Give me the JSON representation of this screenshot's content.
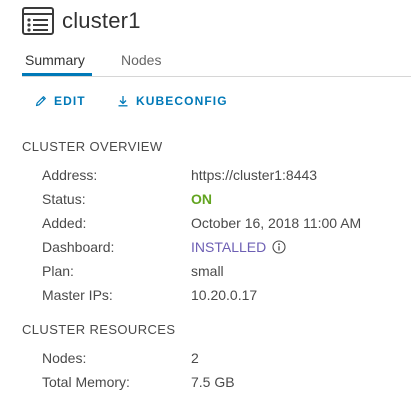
{
  "header": {
    "title": "cluster1",
    "icon": "cluster-list-icon"
  },
  "tabs": [
    {
      "label": "Summary",
      "active": true
    },
    {
      "label": "Nodes",
      "active": false
    }
  ],
  "actions": {
    "edit_label": "EDIT",
    "kubeconfig_label": "KUBECONFIG"
  },
  "overview": {
    "title": "CLUSTER OVERVIEW",
    "rows": [
      {
        "label": "Address:",
        "value": "https://cluster1:8443"
      },
      {
        "label": "Status:",
        "value": "ON"
      },
      {
        "label": "Added:",
        "value": "October 16, 2018 11:00 AM"
      },
      {
        "label": "Dashboard:",
        "value": "INSTALLED"
      },
      {
        "label": "Plan:",
        "value": "small"
      },
      {
        "label": "Master IPs:",
        "value": "10.20.0.17"
      }
    ]
  },
  "resources": {
    "title": "CLUSTER RESOURCES",
    "rows": [
      {
        "label": "Nodes:",
        "value": "2"
      },
      {
        "label": "Total Memory:",
        "value": "7.5 GB"
      }
    ]
  },
  "colors": {
    "accent": "#0079b8",
    "status_on": "#62a420",
    "installed": "#6d5fb4"
  }
}
